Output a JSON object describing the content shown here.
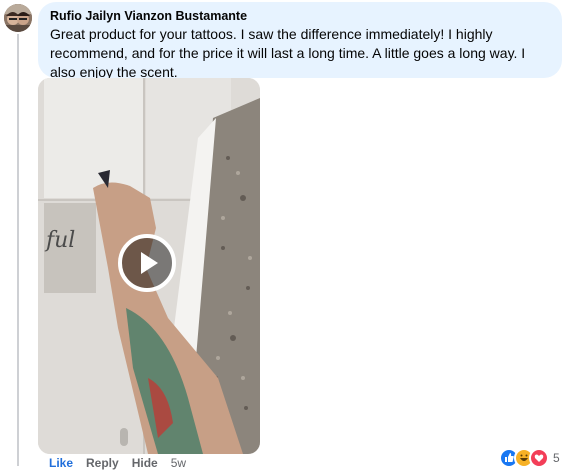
{
  "comment": {
    "author": "Rufio Jailyn Vianzon Bustamante",
    "text": "Great product for your tattoos. I saw the difference immediately! I highly recommend, and for the price it will last a long time. A little goes a long way. I also enjoy the scent."
  },
  "video": {
    "play_icon": "play-icon",
    "partial_text": "ful"
  },
  "reactions": {
    "icons": [
      "like-icon",
      "haha-icon",
      "love-icon"
    ],
    "colors": {
      "like": "#1877f2",
      "haha": "#f7b125",
      "love": "#f33e58"
    },
    "count": "5"
  },
  "actions": {
    "like": "Like",
    "reply": "Reply",
    "hide": "Hide",
    "time": "5w"
  },
  "colors": {
    "bubble": "#e7f3ff",
    "like_active": "#216fdb",
    "muted": "#65676b"
  }
}
